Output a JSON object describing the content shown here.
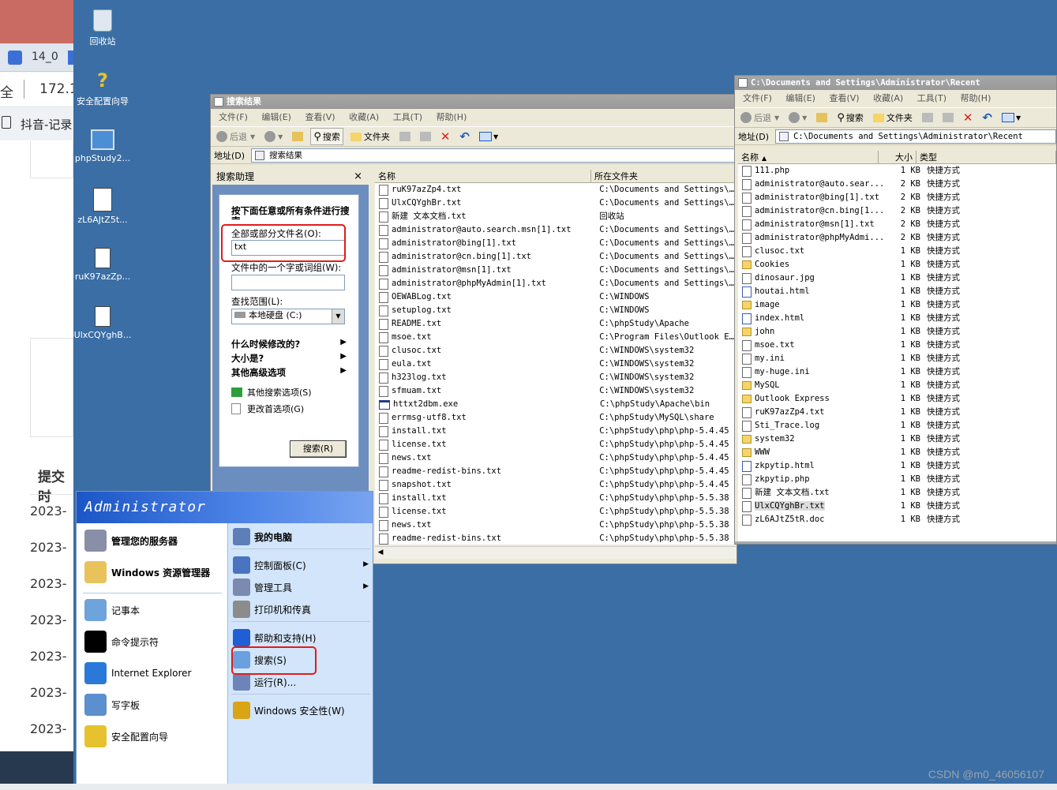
{
  "host": {
    "tab_text": "14_0",
    "addr_prefix": "全",
    "addr_ip": "172.1",
    "bookmark": "抖音-记录",
    "section_label": "提交时",
    "dates": [
      "2023-",
      "2023-",
      "2023-",
      "2023-",
      "2023-",
      "2023-",
      "2023-"
    ]
  },
  "desktop": {
    "icons": [
      {
        "label": "回收站"
      },
      {
        "label": "安全配置向导"
      },
      {
        "label": "phpStudy2..."
      },
      {
        "label": "zL6AJtZ5t..."
      },
      {
        "label": "ruK97azZp..."
      },
      {
        "label": "UlxCQYghB..."
      }
    ]
  },
  "search_window": {
    "title": "搜索结果",
    "menu": [
      "文件(F)",
      "编辑(E)",
      "查看(V)",
      "收藏(A)",
      "工具(T)",
      "帮助(H)"
    ],
    "toolbar": {
      "back": "后退",
      "search": "搜索",
      "folders": "文件夹"
    },
    "address_label": "地址(D)",
    "address_value": "搜索结果",
    "assistant": {
      "header": "搜索助理",
      "close": "×",
      "heading": "按下面任意或所有条件进行搜索。",
      "filename_label": "全部或部分文件名(O):",
      "filename_value": "txt",
      "word_label": "文件中的一个字或词组(W):",
      "word_value": "",
      "lookin_label": "查找范围(L):",
      "lookin_value": "本地硬盘 (C:)",
      "when_modified": "什么时候修改的?",
      "size": "大小是?",
      "advanced": "其他高级选项",
      "other_search": "其他搜索选项(S)",
      "change_prefs": "更改首选项(G)",
      "search_button": "搜索(R)"
    },
    "columns": {
      "name": "名称",
      "folder": "所在文件夹"
    },
    "rows": [
      {
        "name": "ruK97azZp4.txt",
        "folder": "C:\\Documents and Settings\\Admi"
      },
      {
        "name": "UlxCQYghBr.txt",
        "folder": "C:\\Documents and Settings\\Admi"
      },
      {
        "name": "新建 文本文档.txt",
        "folder": "回收站"
      },
      {
        "name": "administrator@auto.search.msn[1].txt",
        "folder": "C:\\Documents and Settings\\Admi"
      },
      {
        "name": "administrator@bing[1].txt",
        "folder": "C:\\Documents and Settings\\Admi"
      },
      {
        "name": "administrator@cn.bing[1].txt",
        "folder": "C:\\Documents and Settings\\Admi"
      },
      {
        "name": "administrator@msn[1].txt",
        "folder": "C:\\Documents and Settings\\Admi"
      },
      {
        "name": "administrator@phpMyAdmin[1].txt",
        "folder": "C:\\Documents and Settings\\Admi"
      },
      {
        "name": "OEWABLog.txt",
        "folder": "C:\\WINDOWS"
      },
      {
        "name": "setuplog.txt",
        "folder": "C:\\WINDOWS"
      },
      {
        "name": "README.txt",
        "folder": "C:\\phpStudy\\Apache"
      },
      {
        "name": "msoe.txt",
        "folder": "C:\\Program Files\\Outlook Expre"
      },
      {
        "name": "clusoc.txt",
        "folder": "C:\\WINDOWS\\system32"
      },
      {
        "name": "eula.txt",
        "folder": "C:\\WINDOWS\\system32"
      },
      {
        "name": "h323log.txt",
        "folder": "C:\\WINDOWS\\system32"
      },
      {
        "name": "sfmuam.txt",
        "folder": "C:\\WINDOWS\\system32"
      },
      {
        "name": "httxt2dbm.exe",
        "folder": "C:\\phpStudy\\Apache\\bin"
      },
      {
        "name": "errmsg-utf8.txt",
        "folder": "C:\\phpStudy\\MySQL\\share"
      },
      {
        "name": "install.txt",
        "folder": "C:\\phpStudy\\php\\php-5.4.45"
      },
      {
        "name": "license.txt",
        "folder": "C:\\phpStudy\\php\\php-5.4.45"
      },
      {
        "name": "news.txt",
        "folder": "C:\\phpStudy\\php\\php-5.4.45"
      },
      {
        "name": "readme-redist-bins.txt",
        "folder": "C:\\phpStudy\\php\\php-5.4.45"
      },
      {
        "name": "snapshot.txt",
        "folder": "C:\\phpStudy\\php\\php-5.4.45"
      },
      {
        "name": "install.txt",
        "folder": "C:\\phpStudy\\php\\php-5.5.38"
      },
      {
        "name": "license.txt",
        "folder": "C:\\phpStudy\\php\\php-5.5.38"
      },
      {
        "name": "news.txt",
        "folder": "C:\\phpStudy\\php\\php-5.5.38"
      },
      {
        "name": "readme-redist-bins.txt",
        "folder": "C:\\phpStudy\\php\\php-5.5.38"
      }
    ]
  },
  "recent_window": {
    "title": "C:\\Documents and Settings\\Administrator\\Recent",
    "menu": [
      "文件(F)",
      "编辑(E)",
      "查看(V)",
      "收藏(A)",
      "工具(T)",
      "帮助(H)"
    ],
    "toolbar": {
      "back": "后退",
      "search": "搜索",
      "folders": "文件夹"
    },
    "address_label": "地址(D)",
    "address_value": "C:\\Documents and Settings\\Administrator\\Recent",
    "columns": {
      "name": "名称",
      "size": "大小",
      "type": "类型"
    },
    "rows": [
      {
        "name": "111.php",
        "size": "1 KB",
        "type": "快捷方式",
        "icon": "file"
      },
      {
        "name": "administrator@auto.sear...",
        "size": "2 KB",
        "type": "快捷方式",
        "icon": "file"
      },
      {
        "name": "administrator@bing[1].txt",
        "size": "2 KB",
        "type": "快捷方式",
        "icon": "file"
      },
      {
        "name": "administrator@cn.bing[1...",
        "size": "2 KB",
        "type": "快捷方式",
        "icon": "file"
      },
      {
        "name": "administrator@msn[1].txt",
        "size": "2 KB",
        "type": "快捷方式",
        "icon": "file"
      },
      {
        "name": "administrator@phpMyAdmi...",
        "size": "2 KB",
        "type": "快捷方式",
        "icon": "file"
      },
      {
        "name": "clusoc.txt",
        "size": "1 KB",
        "type": "快捷方式",
        "icon": "file"
      },
      {
        "name": "Cookies",
        "size": "1 KB",
        "type": "快捷方式",
        "icon": "folder"
      },
      {
        "name": "dinosaur.jpg",
        "size": "1 KB",
        "type": "快捷方式",
        "icon": "file"
      },
      {
        "name": "houtai.html",
        "size": "1 KB",
        "type": "快捷方式",
        "icon": "html"
      },
      {
        "name": "image",
        "size": "1 KB",
        "type": "快捷方式",
        "icon": "folder"
      },
      {
        "name": "index.html",
        "size": "1 KB",
        "type": "快捷方式",
        "icon": "html"
      },
      {
        "name": "john",
        "size": "1 KB",
        "type": "快捷方式",
        "icon": "folder"
      },
      {
        "name": "msoe.txt",
        "size": "1 KB",
        "type": "快捷方式",
        "icon": "file"
      },
      {
        "name": "my.ini",
        "size": "1 KB",
        "type": "快捷方式",
        "icon": "file"
      },
      {
        "name": "my-huge.ini",
        "size": "1 KB",
        "type": "快捷方式",
        "icon": "file"
      },
      {
        "name": "MySQL",
        "size": "1 KB",
        "type": "快捷方式",
        "icon": "folder"
      },
      {
        "name": "Outlook Express",
        "size": "1 KB",
        "type": "快捷方式",
        "icon": "folder"
      },
      {
        "name": "ruK97azZp4.txt",
        "size": "1 KB",
        "type": "快捷方式",
        "icon": "file"
      },
      {
        "name": "Sti_Trace.log",
        "size": "1 KB",
        "type": "快捷方式",
        "icon": "file"
      },
      {
        "name": "system32",
        "size": "1 KB",
        "type": "快捷方式",
        "icon": "folder"
      },
      {
        "name": "WWW",
        "size": "1 KB",
        "type": "快捷方式",
        "icon": "folder"
      },
      {
        "name": "zkpytip.html",
        "size": "1 KB",
        "type": "快捷方式",
        "icon": "html"
      },
      {
        "name": "zkpytip.php",
        "size": "1 KB",
        "type": "快捷方式",
        "icon": "file"
      },
      {
        "name": "新建 文本文档.txt",
        "size": "1 KB",
        "type": "快捷方式",
        "icon": "file"
      },
      {
        "name": "UlxCQYghBr.txt",
        "size": "1 KB",
        "type": "快捷方式",
        "icon": "file",
        "selected": true
      },
      {
        "name": "zL6AJtZ5tR.doc",
        "size": "1 KB",
        "type": "快捷方式",
        "icon": "file"
      }
    ]
  },
  "start_menu": {
    "user": "Administrator",
    "left_items": [
      {
        "label": "管理您的服务器",
        "bold": true,
        "icon_color": "#8a8fa8"
      },
      {
        "label": "Windows 资源管理器",
        "bold": true,
        "icon_color": "#e8c25a"
      },
      {
        "label": "记事本",
        "bold": false,
        "icon_color": "#6fa3dc"
      },
      {
        "label": "命令提示符",
        "bold": false,
        "icon_color": "#000000"
      },
      {
        "label": "Internet Explorer",
        "bold": false,
        "icon_color": "#2a79d8"
      },
      {
        "label": "写字板",
        "bold": false,
        "icon_color": "#5b8fd0"
      },
      {
        "label": "安全配置向导",
        "bold": false,
        "icon_color": "#e6c22e"
      }
    ],
    "right_items": [
      {
        "label": "我的电脑",
        "bold": true,
        "arrow": false,
        "icon_color": "#5d7fb8"
      },
      {
        "label": "控制面板(C)",
        "bold": false,
        "arrow": true,
        "icon_color": "#4a74c0"
      },
      {
        "label": "管理工具",
        "bold": false,
        "arrow": true,
        "icon_color": "#7a8ab0"
      },
      {
        "label": "打印机和传真",
        "bold": false,
        "arrow": false,
        "icon_color": "#8c8c8c"
      },
      {
        "label": "帮助和支持(H)",
        "bold": false,
        "arrow": false,
        "icon_color": "#1f5ed4"
      },
      {
        "label": "搜索(S)",
        "bold": false,
        "arrow": false,
        "icon_color": "#6aa0df"
      },
      {
        "label": "运行(R)...",
        "bold": false,
        "arrow": false,
        "icon_color": "#6d84b8"
      },
      {
        "label": "Windows 安全性(W)",
        "bold": false,
        "arrow": false,
        "icon_color": "#d9a514"
      }
    ],
    "arrow_glyph": "▶"
  },
  "watermark": "CSDN @m0_46056107",
  "colors": {
    "desktop": "#3a6ea5",
    "highlight_red": "#e21b1b",
    "menu_right": "#d3e5fa"
  }
}
